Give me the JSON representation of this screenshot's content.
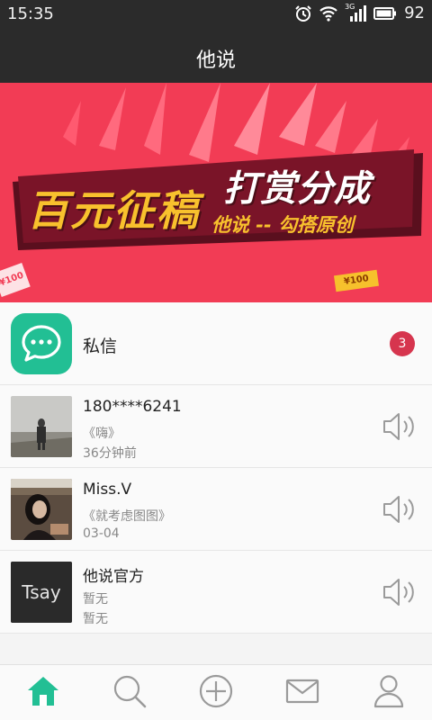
{
  "status_bar": {
    "time": "15:35",
    "network": "3G",
    "battery": "92"
  },
  "header": {
    "title": "他说"
  },
  "banner": {
    "headline": "百元征稿",
    "reward": "打赏分成",
    "subline": "他说 -- 勾搭原创",
    "tag_right": "¥100",
    "tag_left": "¥100"
  },
  "private_message": {
    "label": "私信",
    "unread_count": "3"
  },
  "conversations": [
    {
      "name": "180****6241",
      "title": "《嗨》",
      "time": "36分钟前",
      "avatar": "person-in-fog"
    },
    {
      "name": "Miss.V",
      "title": "《就考虑图图》",
      "time": "03-04",
      "avatar": "woman-portrait"
    },
    {
      "name": "他说官方",
      "title": "暂无",
      "time": "暂无",
      "avatar": "tsay-logo"
    }
  ],
  "official_logo_text": "Tsay",
  "nav": {
    "items": [
      "home-icon",
      "search-icon",
      "add-icon",
      "message-icon",
      "profile-icon"
    ],
    "active": "home-icon"
  },
  "colors": {
    "accent": "#22bf94",
    "banner_bg": "#f23c55",
    "badge": "#d6354e",
    "dark_bar": "#2b2b2b"
  }
}
